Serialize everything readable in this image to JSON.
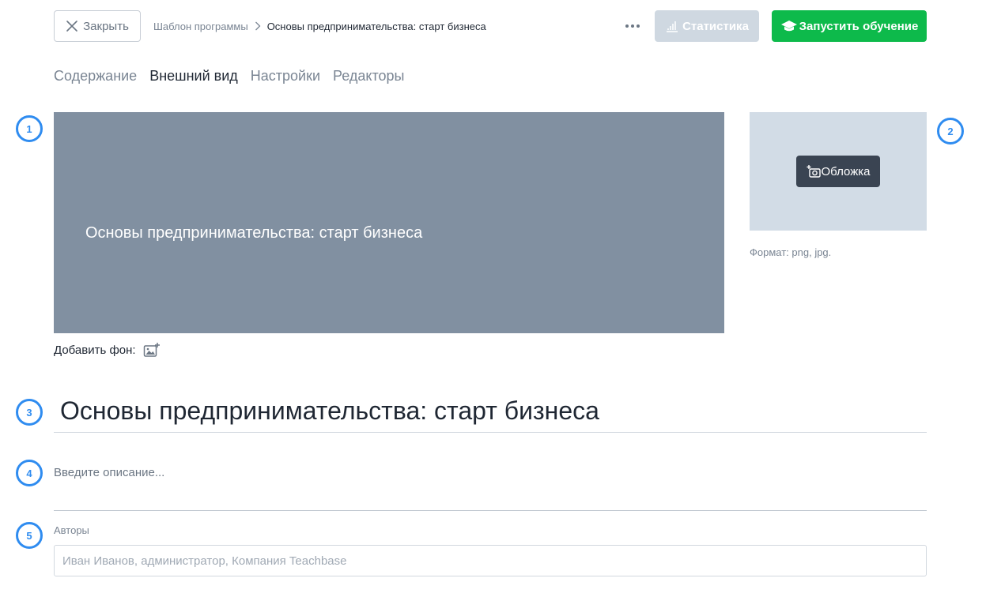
{
  "topbar": {
    "close_label": "Закрыть",
    "breadcrumb": {
      "parent": "Шаблон программы",
      "current": "Основы предпринимательства: старт бизнеса"
    },
    "stats_label": "Статистика",
    "launch_label": "Запустить обучение"
  },
  "tabs": [
    {
      "label": "Содержание",
      "active": false
    },
    {
      "label": "Внешний вид",
      "active": true
    },
    {
      "label": "Настройки",
      "active": false
    },
    {
      "label": "Редакторы",
      "active": false
    }
  ],
  "markers": [
    "1",
    "2",
    "3",
    "4",
    "5"
  ],
  "banner": {
    "title": "Основы предпринимательства: старт бизнеса",
    "add_background_label": "Добавить фон:"
  },
  "cover": {
    "button_label": "Обложка",
    "format_hint": "Формат: png, jpg."
  },
  "title_field": {
    "value": "Основы предпринимательства: старт бизнеса"
  },
  "description": {
    "placeholder": "Введите описание..."
  },
  "authors": {
    "label": "Авторы",
    "placeholder": "Иван Иванов, администратор, Компания Teachbase"
  },
  "colors": {
    "primary_green": "#0dba4b",
    "disabled_button": "#cfd8e1",
    "banner_bg": "#8190a1",
    "cover_bg": "#d2dce6",
    "cover_button": "#3a4452",
    "marker_blue": "#2f8cf0"
  }
}
